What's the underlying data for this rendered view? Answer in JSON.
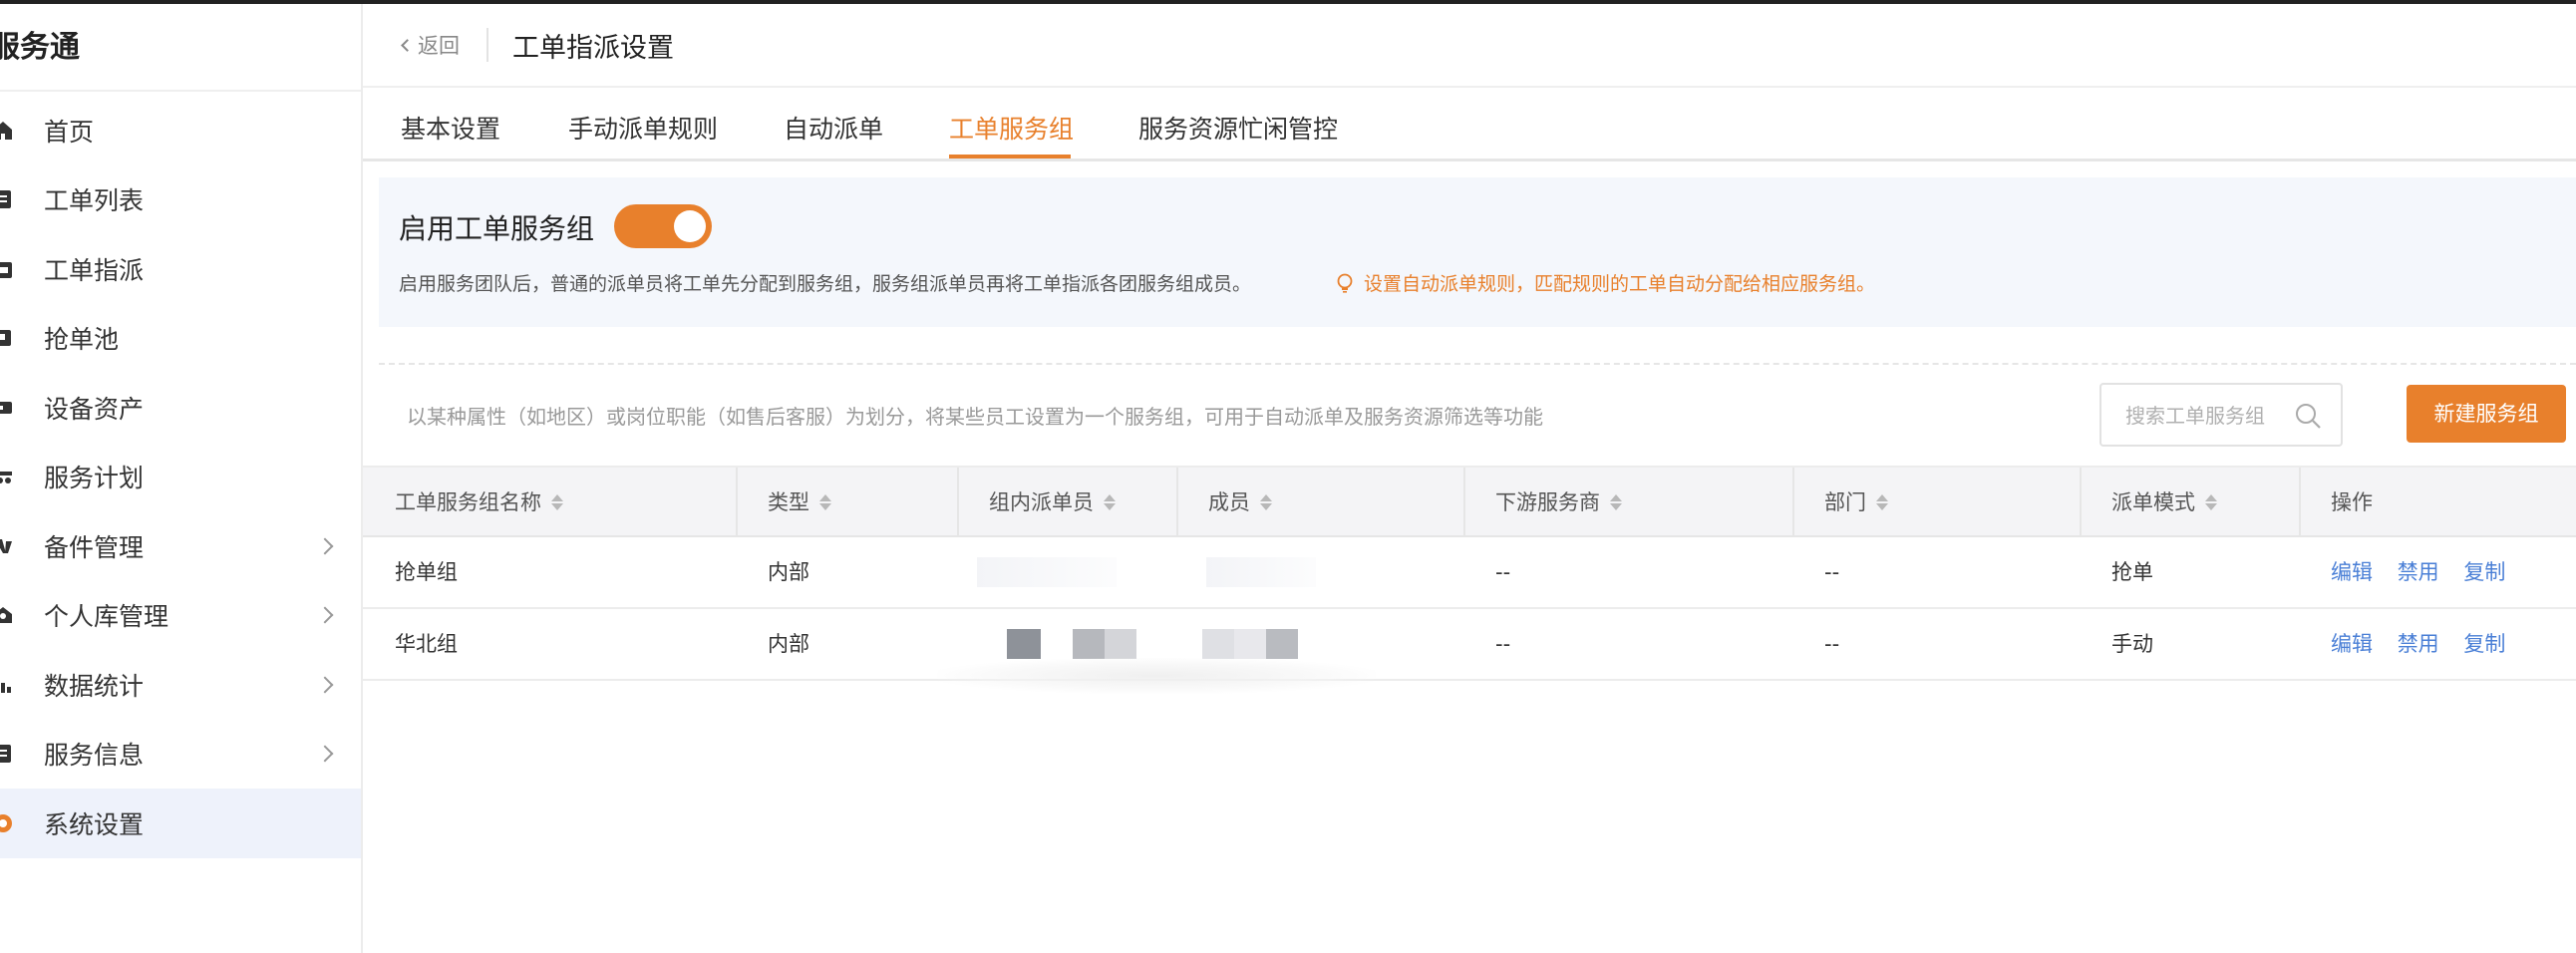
{
  "app": {
    "brand": "服务通"
  },
  "sidebar": {
    "items": [
      {
        "label": "首页",
        "icon": "home-icon",
        "arrow": false
      },
      {
        "label": "工单列表",
        "icon": "list-icon",
        "arrow": false
      },
      {
        "label": "工单指派",
        "icon": "dispatch-icon",
        "arrow": false
      },
      {
        "label": "抢单池",
        "icon": "pool-icon",
        "arrow": false
      },
      {
        "label": "设备资产",
        "icon": "device-icon",
        "arrow": false
      },
      {
        "label": "服务计划",
        "icon": "plan-icon",
        "arrow": false
      },
      {
        "label": "备件管理",
        "icon": "parts-icon",
        "arrow": true
      },
      {
        "label": "个人库管理",
        "icon": "personal-stock-icon",
        "arrow": true
      },
      {
        "label": "数据统计",
        "icon": "chart-icon",
        "arrow": true
      },
      {
        "label": "服务信息",
        "icon": "info-icon",
        "arrow": true
      },
      {
        "label": "系统设置",
        "icon": "gear-icon",
        "arrow": false,
        "active": true
      }
    ]
  },
  "header": {
    "back_label": "返回",
    "title": "工单指派设置"
  },
  "tabs": [
    {
      "label": "基本设置"
    },
    {
      "label": "手动派单规则"
    },
    {
      "label": "自动派单"
    },
    {
      "label": "工单服务组",
      "active": true
    },
    {
      "label": "服务资源忙闲管控"
    }
  ],
  "panel": {
    "enable_label": "启用工单服务组",
    "toggle_on": true,
    "description": "启用服务团队后，普通的派单员将工单先分配到服务组，服务组派单员再将工单指派各团服务组成员。",
    "link_text": "设置自动派单规则，匹配规则的工单自动分配给相应服务组。"
  },
  "toolbar": {
    "description": "以某种属性（如地区）或岗位职能（如售后客服）为划分，将某些员工设置为一个服务组，可用于自动派单及服务资源筛选等功能",
    "search_placeholder": "搜索工单服务组",
    "new_button": "新建服务组"
  },
  "table": {
    "columns": [
      "工单服务组名称",
      "类型",
      "组内派单员",
      "成员",
      "下游服务商",
      "部门",
      "派单模式",
      "操作"
    ],
    "rows": [
      {
        "name": "抢单组",
        "type": "内部",
        "vendor": "--",
        "dept": "--",
        "mode": "抢单"
      },
      {
        "name": "华北组",
        "type": "内部",
        "vendor": "--",
        "dept": "--",
        "mode": "手动"
      }
    ],
    "actions": [
      "编辑",
      "禁用",
      "复制"
    ]
  },
  "colors": {
    "accent": "#e8802c",
    "link": "#4a7fd6",
    "panel_bg": "#f4f7fc"
  }
}
